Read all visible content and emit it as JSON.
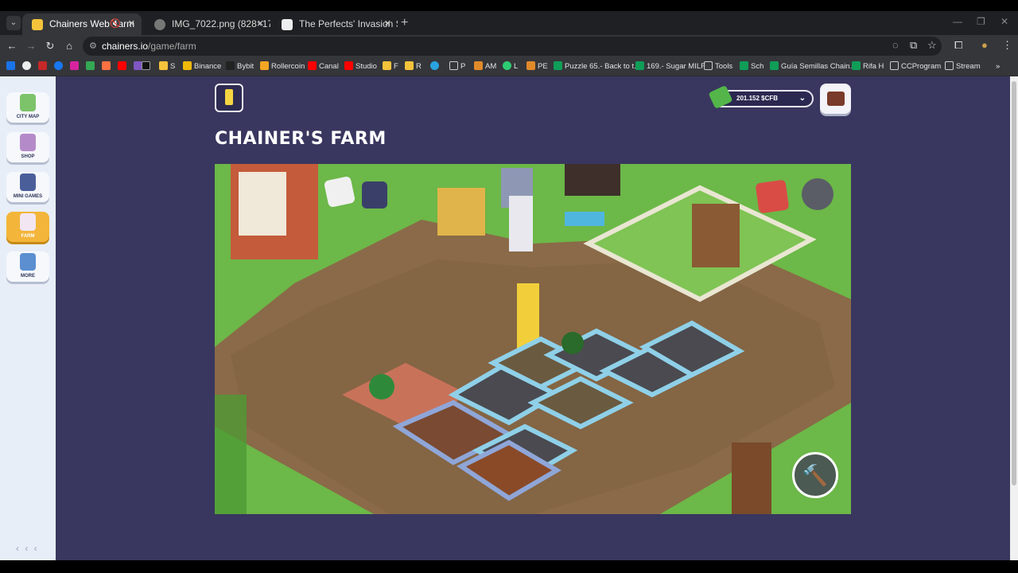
{
  "browser": {
    "tabs": [
      {
        "title": "Chainers Web Farm",
        "active": true
      },
      {
        "title": "IMG_7022.png (828×1792)",
        "active": false
      },
      {
        "title": "The Perfects' Invasion Sprint #0",
        "active": false
      }
    ],
    "url_host": "chainers.io",
    "url_path": "/game/farm",
    "bookmarks": [
      "S",
      "Binance",
      "Bybit",
      "Rollercoin",
      "Canal",
      "Studio",
      "F",
      "R",
      "P",
      "AM",
      "L",
      "PE",
      "Puzzle 65.- Back to t...",
      "169.- Sugar MILF",
      "Tools",
      "Sch",
      "Guía Semillas Chain...",
      "Rifa H",
      "CCProgram",
      "Stream"
    ]
  },
  "sidebar": {
    "items": [
      {
        "label": "CITY MAP",
        "icon": "map-pin-icon",
        "active": false
      },
      {
        "label": "SHOP",
        "icon": "shop-icon",
        "active": false
      },
      {
        "label": "MINI GAMES",
        "icon": "gamepad-icon",
        "active": false
      },
      {
        "label": "FARM",
        "icon": "cow-icon",
        "active": true
      },
      {
        "label": "MORE",
        "icon": "grid-icon",
        "active": false
      }
    ],
    "collapse_label": "‹ ‹ ‹"
  },
  "header": {
    "title": "CHAINER'S FARM",
    "balance": "201.152 $CFB"
  },
  "colors": {
    "page_bg": "#39375f",
    "sidebar_bg": "#e8eef8",
    "active_item": "#f3b53a",
    "grass": "#6cb848",
    "soil": "#8a6a48"
  }
}
